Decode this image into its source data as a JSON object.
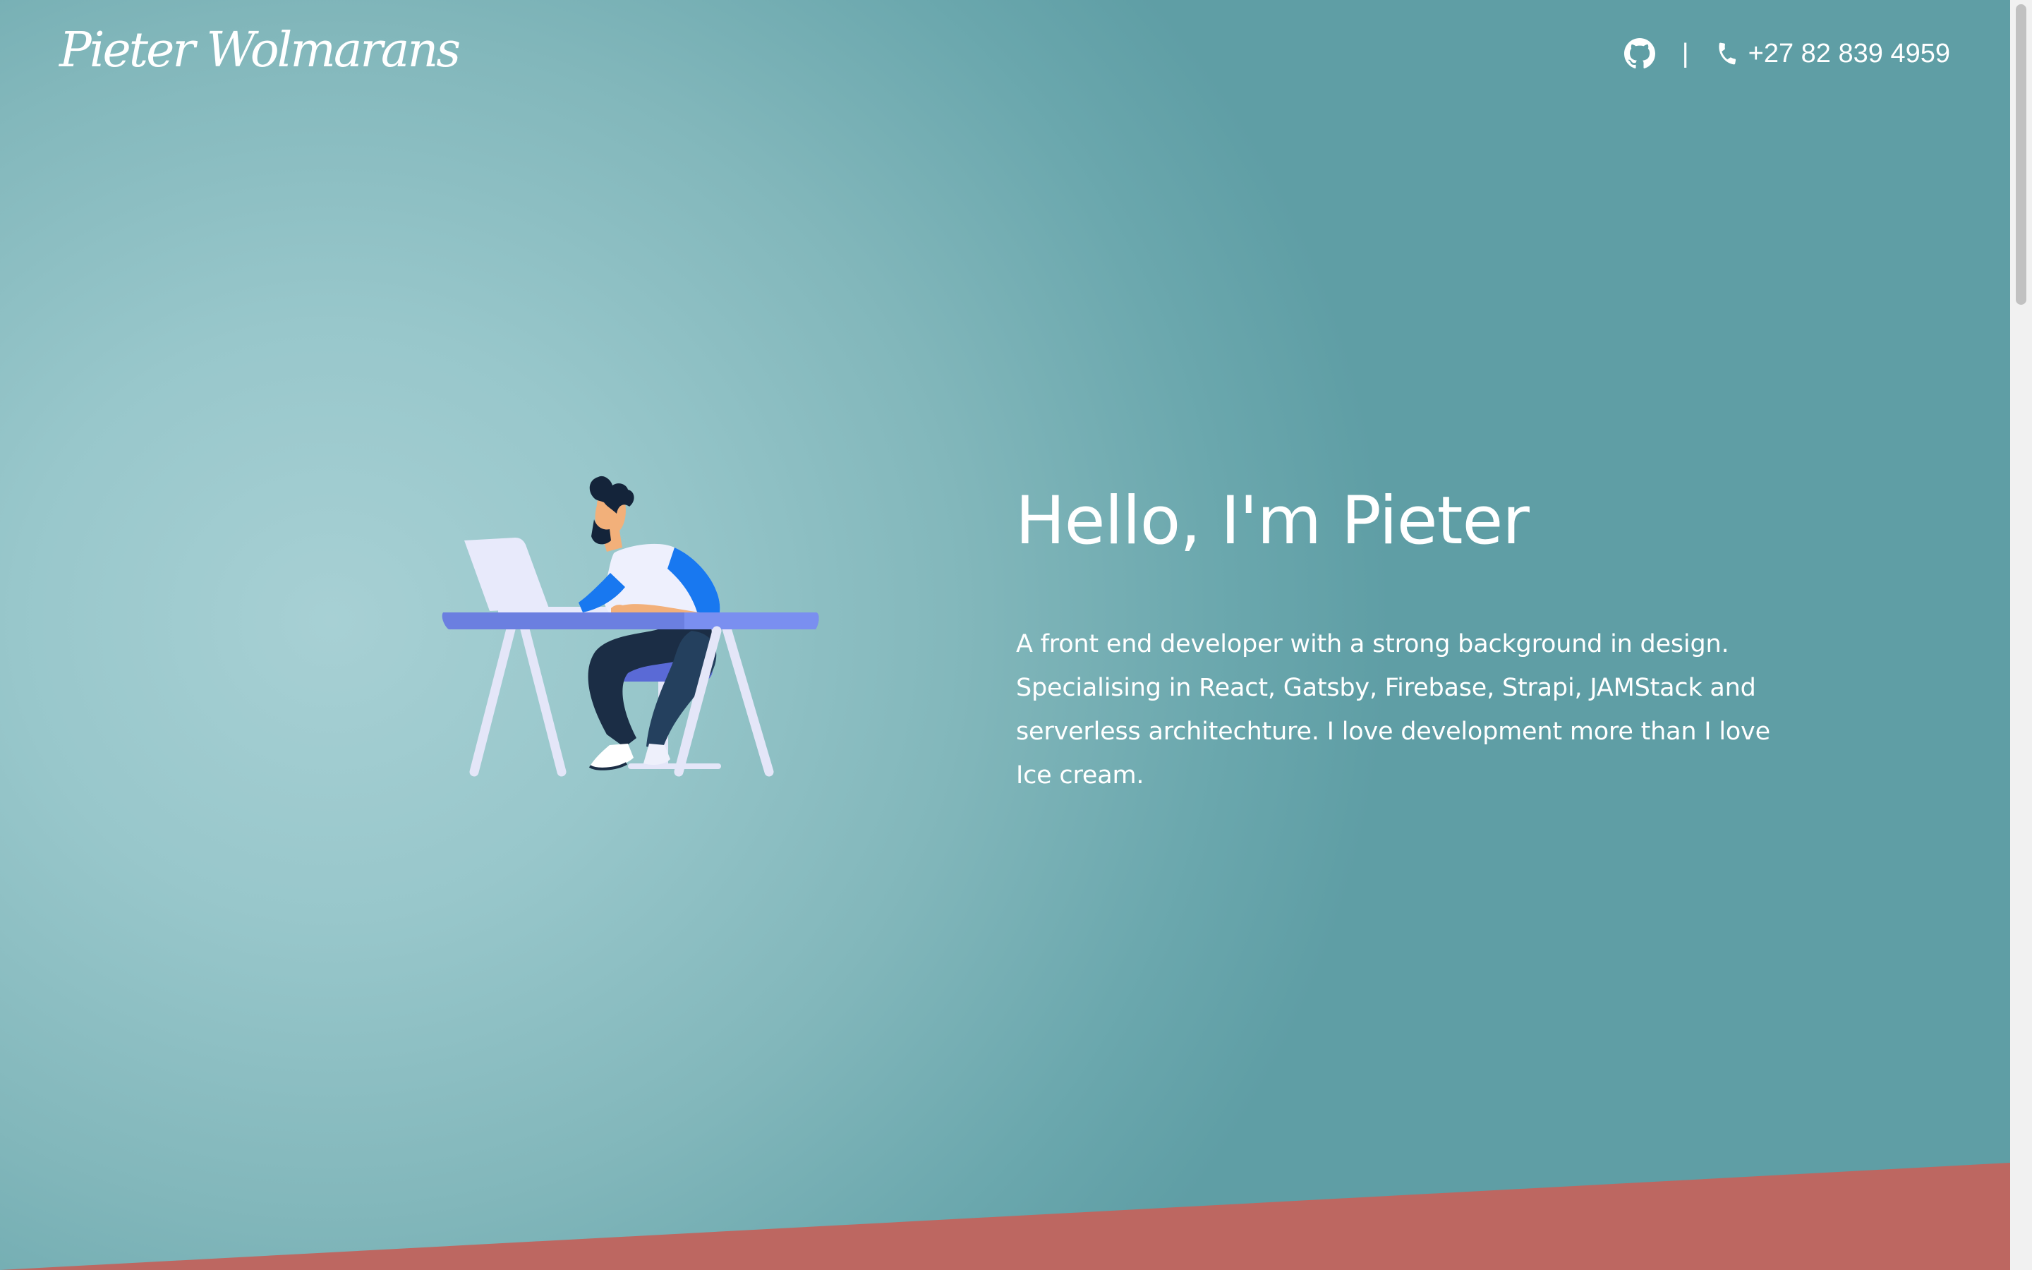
{
  "brand": {
    "name": "Pieter Wolmarans"
  },
  "nav": {
    "github_icon": "github-icon",
    "separator": "|",
    "phone_icon": "phone-icon",
    "phone": "+27 82 839 4959"
  },
  "hero": {
    "headline": "Hello, I'm Pieter",
    "intro": "A front end developer with a strong background in design. Specialising in React, Gatsby, Firebase, Strapi, JAMStack and serverless architechture. I love development more than I love Ice cream.",
    "illustration": "developer-at-desk-illustration"
  },
  "colors": {
    "background_teal": "#8fc0c4",
    "accent_red": "#bd6761",
    "text": "#ffffff",
    "desk_blue": "#6b7fe0",
    "shirt_blue": "#1878f0"
  }
}
